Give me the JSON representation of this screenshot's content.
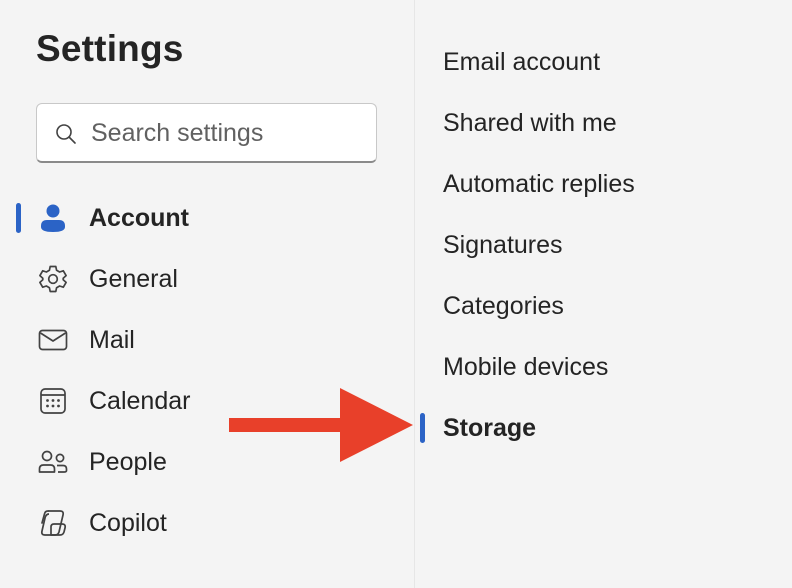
{
  "settings": {
    "title": "Settings",
    "search": {
      "placeholder": "Search settings",
      "value": ""
    }
  },
  "nav": {
    "items": [
      {
        "label": "Account",
        "icon": "person-icon",
        "selected": true
      },
      {
        "label": "General",
        "icon": "gear-icon",
        "selected": false
      },
      {
        "label": "Mail",
        "icon": "mail-icon",
        "selected": false
      },
      {
        "label": "Calendar",
        "icon": "calendar-icon",
        "selected": false
      },
      {
        "label": "People",
        "icon": "people-icon",
        "selected": false
      },
      {
        "label": "Copilot",
        "icon": "copilot-icon",
        "selected": false
      }
    ]
  },
  "account_menu": {
    "items": [
      {
        "label": "Email account",
        "selected": false
      },
      {
        "label": "Shared with me",
        "selected": false
      },
      {
        "label": "Automatic replies",
        "selected": false
      },
      {
        "label": "Signatures",
        "selected": false
      },
      {
        "label": "Categories",
        "selected": false
      },
      {
        "label": "Mobile devices",
        "selected": false
      },
      {
        "label": "Storage",
        "selected": true
      }
    ]
  },
  "colors": {
    "accent": "#2b63c6",
    "annotation_arrow": "#e8402a",
    "background": "#f4f4f4"
  }
}
